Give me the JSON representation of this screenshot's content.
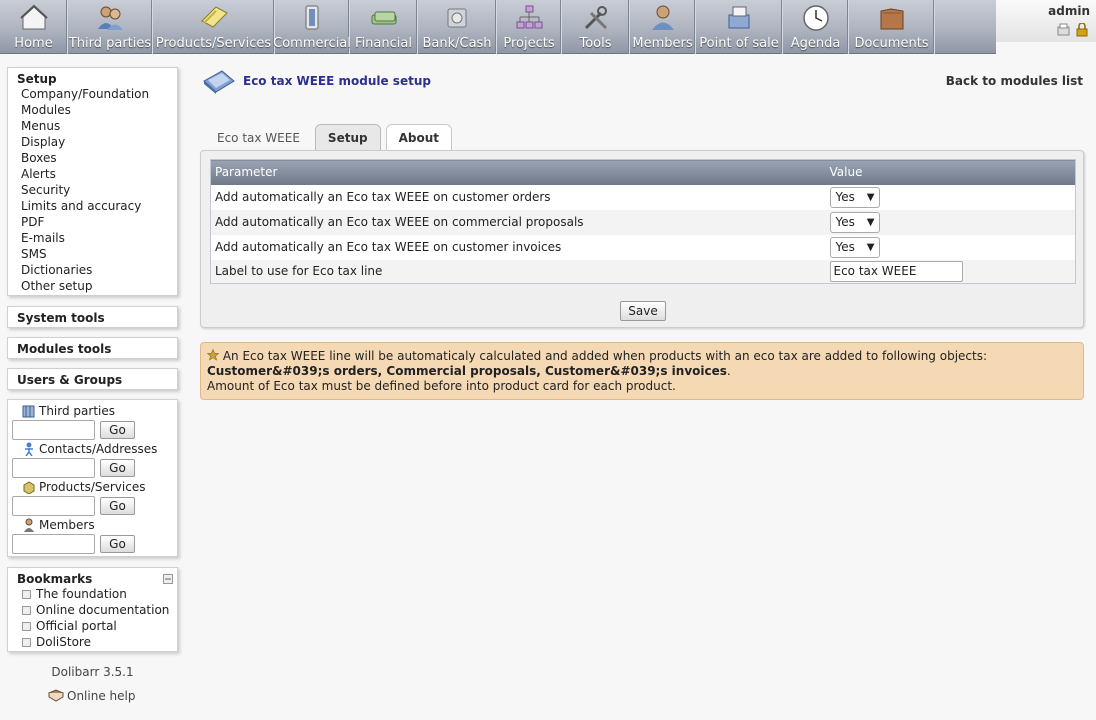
{
  "topmenu": [
    {
      "label": "Home",
      "icon": "home-icon",
      "width": 68
    },
    {
      "label": "Third parties",
      "icon": "third-parties-icon",
      "width": 85
    },
    {
      "label": "Products/Services",
      "icon": "products-icon",
      "width": 122
    },
    {
      "label": "Commercial",
      "icon": "commercial-icon",
      "width": 75
    },
    {
      "label": "Financial",
      "icon": "financial-icon",
      "width": 68
    },
    {
      "label": "Bank/Cash",
      "icon": "bank-icon",
      "width": 79
    },
    {
      "label": "Projects",
      "icon": "projects-icon",
      "width": 65
    },
    {
      "label": "Tools",
      "icon": "tools-icon",
      "width": 68
    },
    {
      "label": "Members",
      "icon": "members-icon",
      "width": 66
    },
    {
      "label": "Point of sale",
      "icon": "pos-icon",
      "width": 87
    },
    {
      "label": "Agenda",
      "icon": "agenda-icon",
      "width": 66
    },
    {
      "label": "Documents",
      "icon": "documents-icon",
      "width": 86
    }
  ],
  "login": {
    "user": "admin"
  },
  "setup_menu": {
    "title": "Setup",
    "items": [
      "Company/Foundation",
      "Modules",
      "Menus",
      "Display",
      "Boxes",
      "Alerts",
      "Security",
      "Limits and accuracy",
      "PDF",
      "E-mails",
      "SMS",
      "Dictionaries",
      "Other setup"
    ]
  },
  "system_tools": "System tools",
  "modules_tools": "Modules tools",
  "users_groups": "Users & Groups",
  "search": {
    "go_label": "Go",
    "entries": [
      {
        "label": "Third parties",
        "icon": "third-parties-icon"
      },
      {
        "label": "Contacts/Addresses",
        "icon": "contact-icon"
      },
      {
        "label": "Products/Services",
        "icon": "product-icon"
      },
      {
        "label": "Members",
        "icon": "member-icon"
      }
    ]
  },
  "bookmarks": {
    "title": "Bookmarks",
    "items": [
      "The foundation",
      "Online documentation",
      "Official portal",
      "DoliStore"
    ]
  },
  "version": "Dolibarr 3.5.1",
  "help": "Online help",
  "page": {
    "title": "Eco tax WEEE module setup",
    "back": "Back to modules list"
  },
  "tabs": [
    {
      "label": "Eco tax WEEE",
      "state": "plain"
    },
    {
      "label": "Setup",
      "state": "active"
    },
    {
      "label": "About",
      "state": "normal"
    }
  ],
  "table": {
    "col_parameter": "Parameter",
    "col_value": "Value",
    "rows": [
      {
        "label": "Add automatically an Eco tax WEEE on customer orders",
        "type": "select",
        "value": "Yes"
      },
      {
        "label": "Add automatically an Eco tax WEEE on commercial proposals",
        "type": "select",
        "value": "Yes"
      },
      {
        "label": "Add automatically an Eco tax WEEE on customer invoices",
        "type": "select",
        "value": "Yes"
      },
      {
        "label": "Label to use for Eco tax line",
        "type": "text",
        "value": "Eco tax WEEE"
      }
    ]
  },
  "save_label": "Save",
  "info": {
    "line1_prefix": "An Eco tax WEEE line will be automaticaly calculated and added when products with an eco tax are added to following objects: ",
    "line1_bold": "Customer&#039;s orders, Commercial proposals, Customer&#039;s invoices",
    "line1_suffix": ".",
    "line2": "Amount of Eco tax must be defined before into product card for each product."
  }
}
